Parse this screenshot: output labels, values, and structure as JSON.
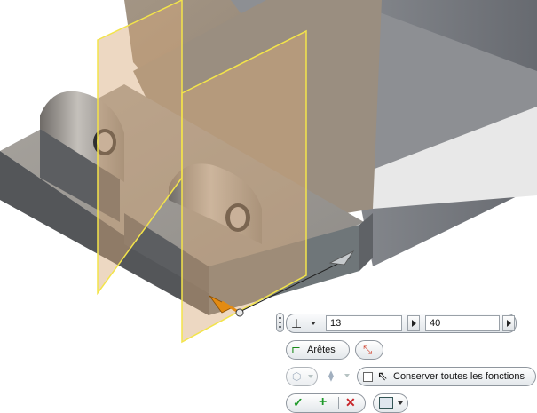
{
  "toolbar": {
    "direction_value": "13",
    "distance_value": "40",
    "edges_label": "Arêtes",
    "keep_all_features_label": "Conserver toutes les fonctions",
    "keep_all_features_checked": false
  },
  "colors": {
    "plane_edge": "#f3e44a",
    "plane_fill": "#d7a877",
    "part_gray": "#7d8086",
    "ok_green": "#1f9a2a",
    "cancel_red": "#c8262a",
    "arrow_orange": "#e38b12"
  }
}
